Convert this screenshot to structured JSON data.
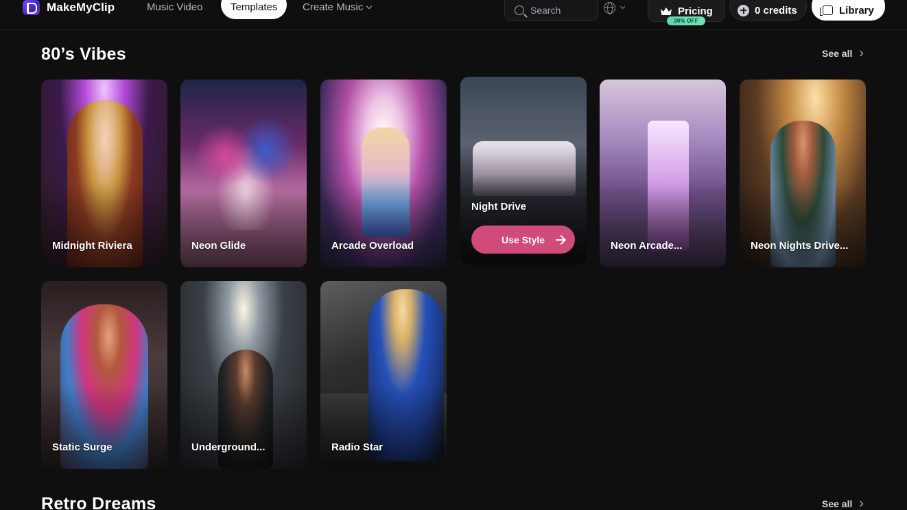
{
  "header": {
    "brand": "MakeMyClip",
    "nav": {
      "music_video": "Music Video",
      "templates": "Templates",
      "create_music": "Create Music"
    },
    "search_label": "Search",
    "pricing_label": "Pricing",
    "pricing_badge": "30% OFF",
    "credits_label": "0 credits",
    "library_label": "Library"
  },
  "sections": [
    {
      "title": "80’s Vibes",
      "see_all": "See all",
      "cards": [
        {
          "label": "Midnight Riviera"
        },
        {
          "label": "Neon Glide"
        },
        {
          "label": "Arcade Overload"
        },
        {
          "label": "Night Drive",
          "action": "Use Style"
        },
        {
          "label": "Neon Arcade..."
        },
        {
          "label": "Neon Nights Drive..."
        },
        {
          "label": "Static Surge"
        },
        {
          "label": "Underground..."
        },
        {
          "label": "Radio Star"
        }
      ]
    },
    {
      "title": "Retro Dreams",
      "see_all": "See all"
    }
  ],
  "colors": {
    "background": "#0f0f10",
    "accent_button": "#d04a7a",
    "badge": "#5cd7b0"
  }
}
